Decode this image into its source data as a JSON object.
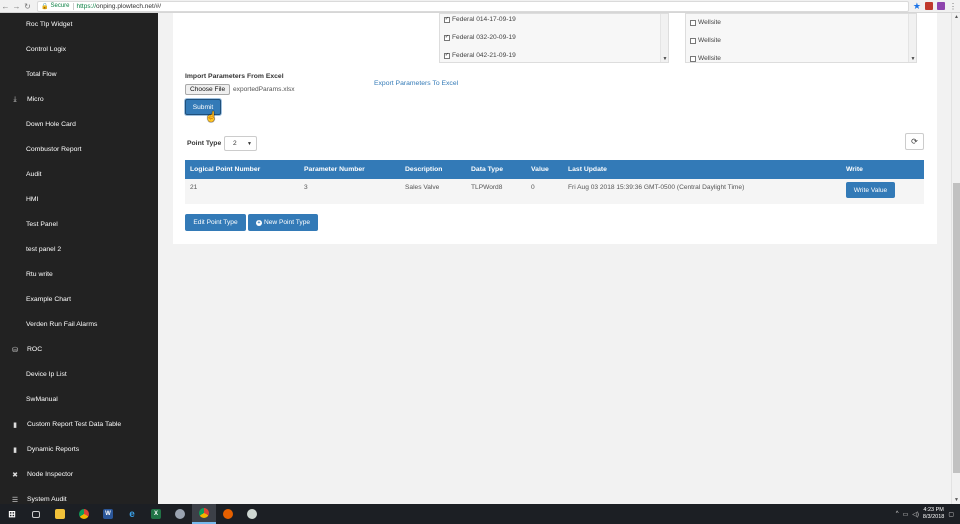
{
  "browser": {
    "secure_label": "Secure",
    "url_protocol": "https://",
    "url_rest": "onping.plowtech.net/#/"
  },
  "sidebar": {
    "items": [
      {
        "label": "Roc Tlp Widget",
        "icon": ""
      },
      {
        "label": "Control Logix",
        "icon": ""
      },
      {
        "label": "Total Flow",
        "icon": ""
      },
      {
        "label": "Micro",
        "icon": "download-icon"
      },
      {
        "label": "Down Hole Card",
        "icon": ""
      },
      {
        "label": "Combustor Report",
        "icon": ""
      },
      {
        "label": "Audit",
        "icon": ""
      },
      {
        "label": "HMI",
        "icon": ""
      },
      {
        "label": "Test Panel",
        "icon": ""
      },
      {
        "label": "test panel 2",
        "icon": ""
      },
      {
        "label": "Rtu write",
        "icon": ""
      },
      {
        "label": "Example Chart",
        "icon": ""
      },
      {
        "label": "Verden Run Fail Alarms",
        "icon": ""
      },
      {
        "label": "ROC",
        "icon": "database-icon"
      },
      {
        "label": "Device Ip List",
        "icon": ""
      },
      {
        "label": "SwManual",
        "icon": ""
      },
      {
        "label": "Custom Report Test Data Table",
        "icon": "bar-chart-icon"
      },
      {
        "label": "Dynamic Reports",
        "icon": "bar-chart-icon"
      },
      {
        "label": "Node Inspector",
        "icon": "cross-icon"
      },
      {
        "label": "System Audit",
        "icon": "list-icon"
      }
    ]
  },
  "lists": {
    "locations": [
      "Federal 014-17-09-19",
      "Federal 032-20-09-19",
      "Federal 042-21-09-19"
    ],
    "sites": [
      "Wellsite",
      "Wellsite",
      "Wellsite"
    ]
  },
  "import": {
    "label": "Import Parameters From Excel",
    "choose_file": "Choose File",
    "file_name": "exportedParams.xlsx",
    "submit": "Submit",
    "export_link": "Export Parameters To Excel"
  },
  "point_type": {
    "label": "Point Type",
    "value": "2"
  },
  "table": {
    "headers": [
      "Logical Point Number",
      "Parameter Number",
      "Description",
      "Data Type",
      "Value",
      "Last Update",
      "Write"
    ],
    "rows": [
      [
        "21",
        "3",
        "Sales Valve",
        "TLPWord8",
        "0",
        "Fri Aug 03 2018 15:39:36 GMT-0500 (Central Daylight Time)",
        "Write Value"
      ]
    ]
  },
  "actions": {
    "edit_point_type": "Edit Point Type",
    "new_point_type": "New Point Type"
  },
  "taskbar": {
    "time": "4:23 PM",
    "date": "8/3/2018"
  },
  "colors": {
    "primary": "#337ab7",
    "sidebar_bg": "#222222"
  }
}
